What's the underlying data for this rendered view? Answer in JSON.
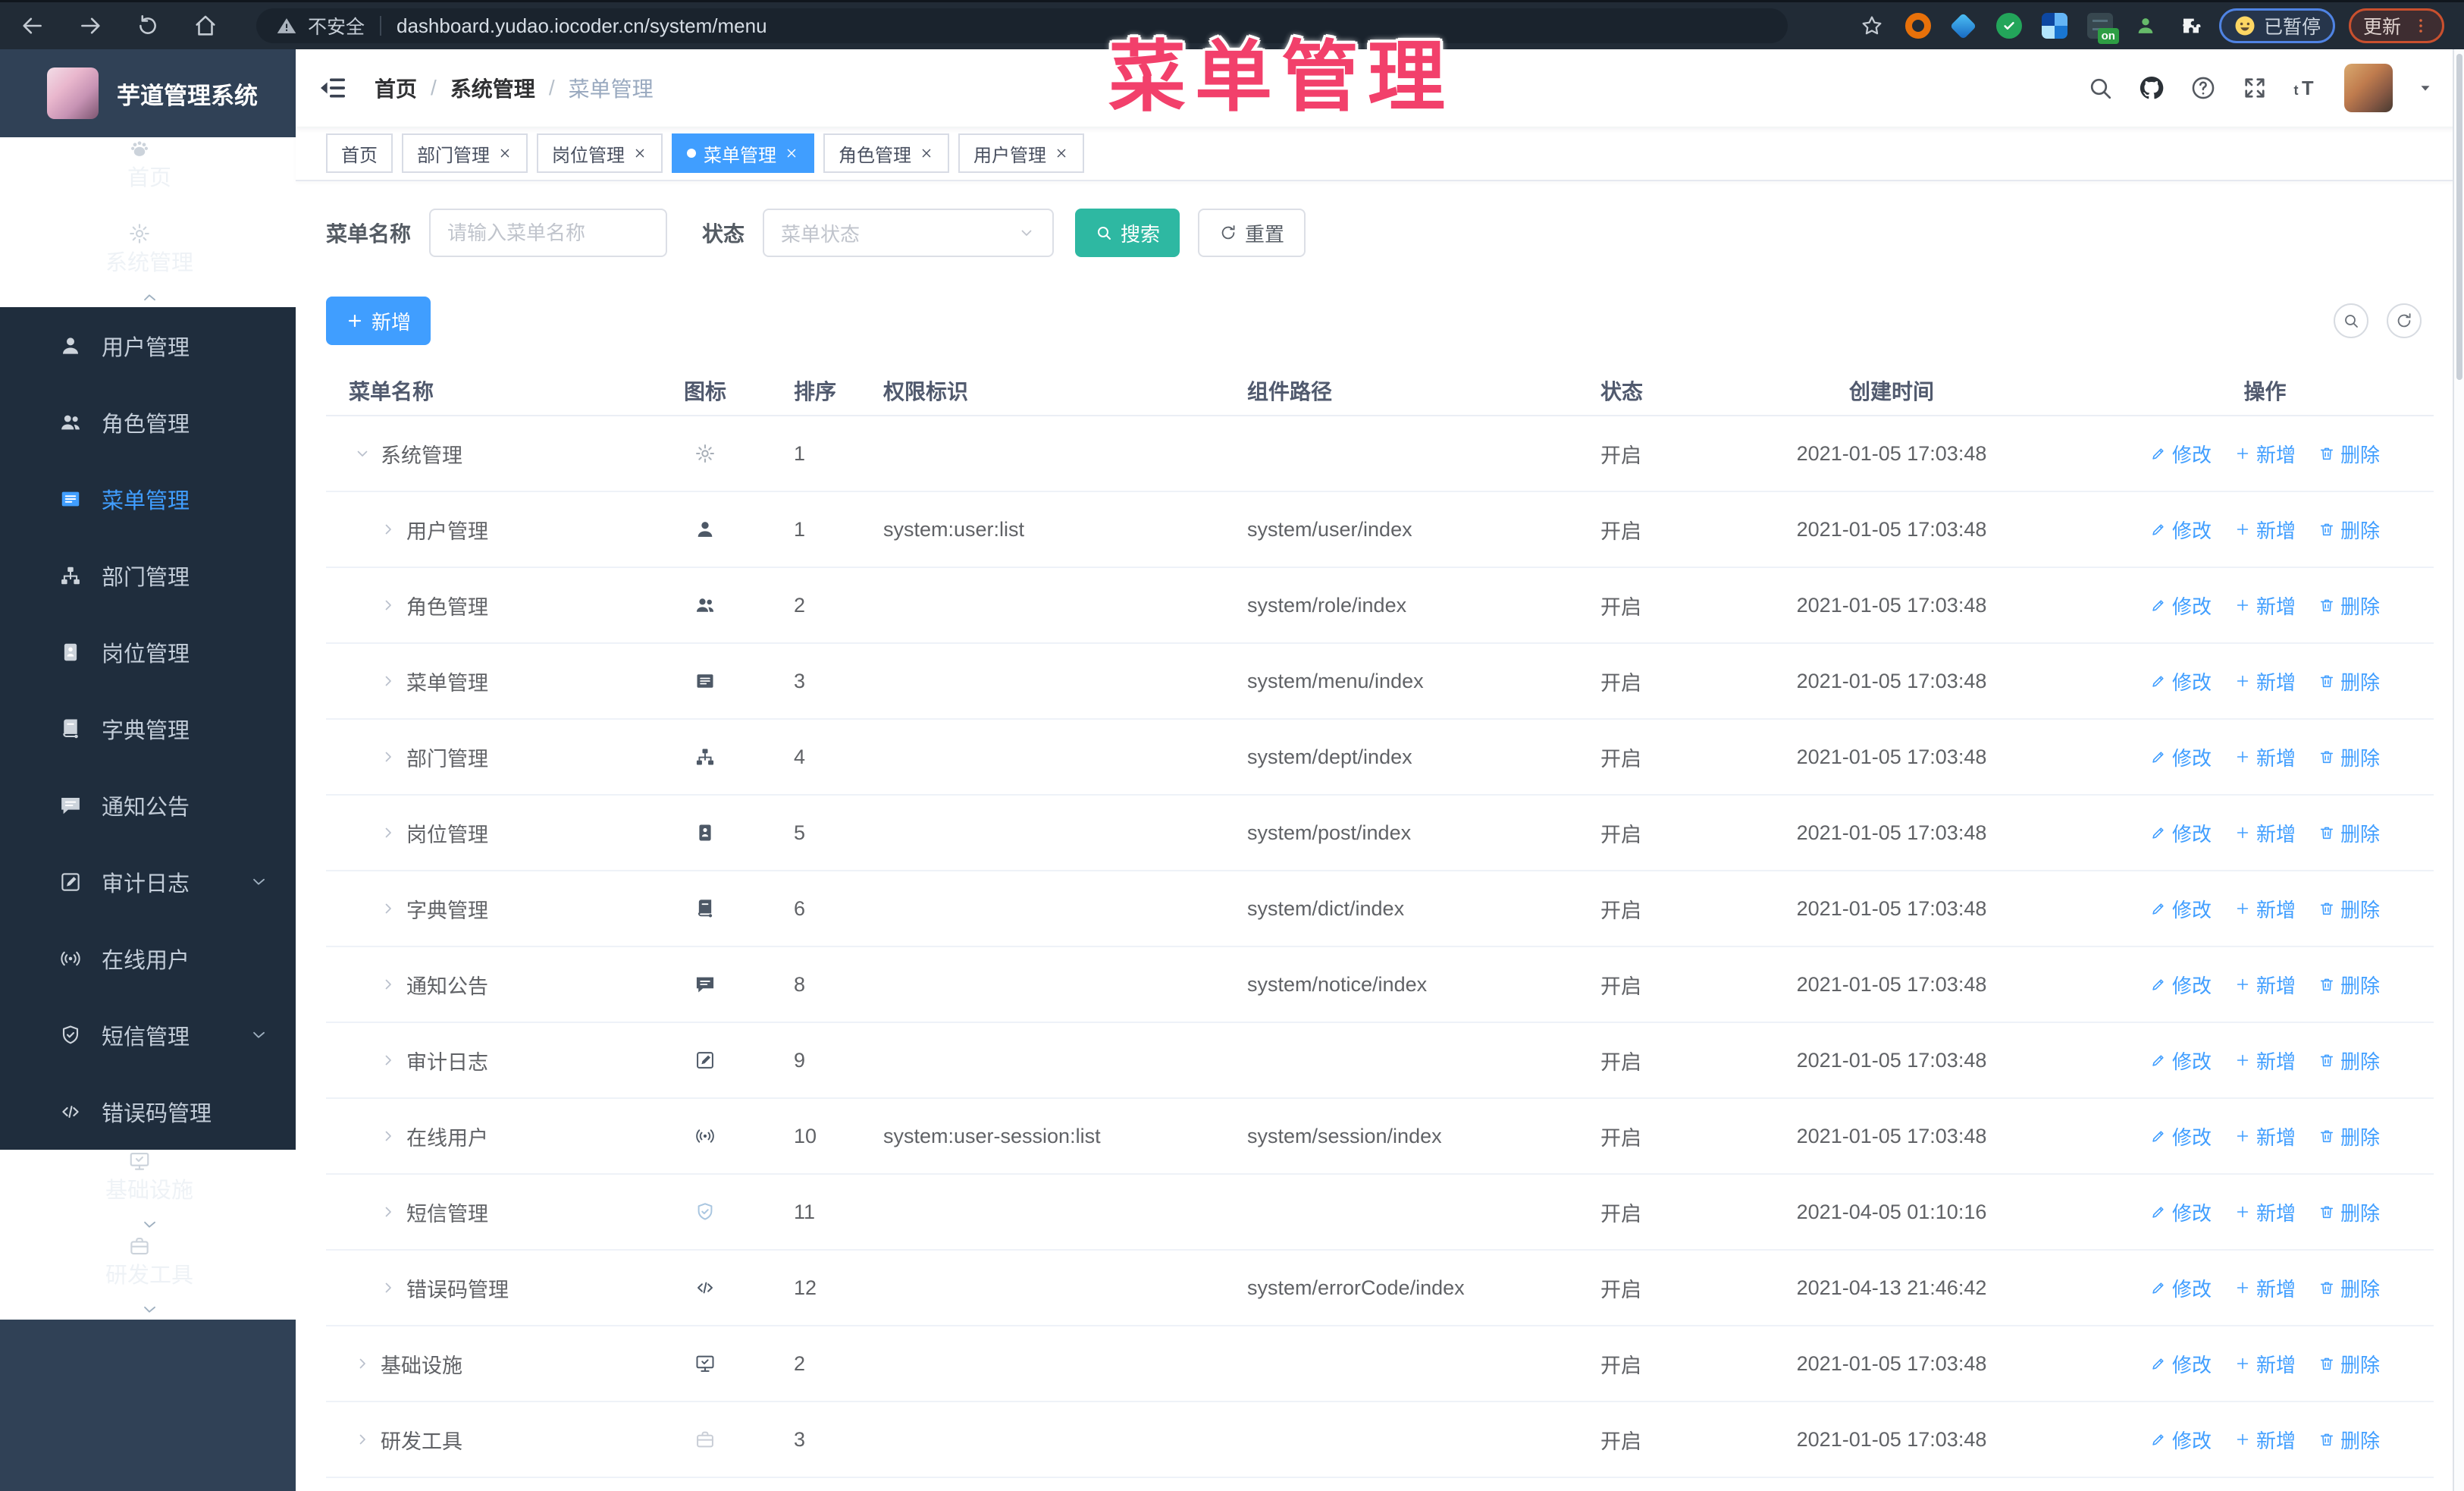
{
  "colors": {
    "primary": "#409eff",
    "search_button_teal": "#2eb8a2",
    "overlay_pink": "#f2406b",
    "sidebar_bg": "#304156",
    "submenu_bg": "#1f2d3d",
    "active_tab_bg": "#409eff"
  },
  "overlay_title": "菜单管理",
  "browser": {
    "security_label": "不安全",
    "url": "dashboard.yudao.iocoder.cn/system/menu",
    "paused_badge": "已暂停",
    "update_badge": "更新",
    "extension_on_badge": "on"
  },
  "sidebar": {
    "logo_title": "芋道管理系统",
    "items": [
      {
        "id": "home",
        "label": "首页",
        "icon": "dashboard",
        "type": "main",
        "active": false,
        "chevron": ""
      },
      {
        "id": "system",
        "label": "系统管理",
        "icon": "gear",
        "type": "main",
        "active": false,
        "chevron": "up"
      },
      {
        "id": "user",
        "label": "用户管理",
        "icon": "user",
        "type": "sub",
        "active": false,
        "chevron": ""
      },
      {
        "id": "role",
        "label": "角色管理",
        "icon": "users",
        "type": "sub",
        "active": false,
        "chevron": ""
      },
      {
        "id": "menu",
        "label": "菜单管理",
        "icon": "menu",
        "type": "sub",
        "active": true,
        "chevron": ""
      },
      {
        "id": "dept",
        "label": "部门管理",
        "icon": "tree",
        "type": "sub",
        "active": false,
        "chevron": ""
      },
      {
        "id": "post",
        "label": "岗位管理",
        "icon": "post",
        "type": "sub",
        "active": false,
        "chevron": ""
      },
      {
        "id": "dict",
        "label": "字典管理",
        "icon": "dict",
        "type": "sub",
        "active": false,
        "chevron": ""
      },
      {
        "id": "notice",
        "label": "通知公告",
        "icon": "notice",
        "type": "sub",
        "active": false,
        "chevron": ""
      },
      {
        "id": "audit-log",
        "label": "审计日志",
        "icon": "log",
        "type": "sub",
        "active": false,
        "chevron": "down"
      },
      {
        "id": "online-user",
        "label": "在线用户",
        "icon": "online",
        "type": "sub",
        "active": false,
        "chevron": ""
      },
      {
        "id": "sms",
        "label": "短信管理",
        "icon": "sms",
        "type": "sub",
        "active": false,
        "chevron": "down"
      },
      {
        "id": "error-code",
        "label": "错误码管理",
        "icon": "code",
        "type": "sub",
        "active": false,
        "chevron": ""
      },
      {
        "id": "infra",
        "label": "基础设施",
        "icon": "infra",
        "type": "main",
        "active": false,
        "chevron": "down"
      },
      {
        "id": "tool",
        "label": "研发工具",
        "icon": "tool",
        "type": "main",
        "active": false,
        "chevron": "down"
      }
    ]
  },
  "navbar": {
    "breadcrumb": [
      "首页",
      "系统管理",
      "菜单管理"
    ],
    "separator": "/"
  },
  "tags": [
    {
      "id": "home",
      "label": "首页",
      "closable": false,
      "active": false
    },
    {
      "id": "dept",
      "label": "部门管理",
      "closable": true,
      "active": false
    },
    {
      "id": "post",
      "label": "岗位管理",
      "closable": true,
      "active": false
    },
    {
      "id": "menu",
      "label": "菜单管理",
      "closable": true,
      "active": true
    },
    {
      "id": "role",
      "label": "角色管理",
      "closable": true,
      "active": false
    },
    {
      "id": "user",
      "label": "用户管理",
      "closable": true,
      "active": false
    }
  ],
  "filter": {
    "name_label": "菜单名称",
    "name_placeholder": "请输入菜单名称",
    "status_label": "状态",
    "status_placeholder": "菜单状态",
    "search_label": "搜索",
    "reset_label": "重置"
  },
  "toolbar": {
    "add_label": "新增"
  },
  "table": {
    "columns": [
      "菜单名称",
      "图标",
      "排序",
      "权限标识",
      "组件路径",
      "状态",
      "创建时间",
      "操作"
    ],
    "action_labels": [
      "修改",
      "新增",
      "删除"
    ],
    "rows": [
      {
        "name": "系统管理",
        "level": 0,
        "expanded": true,
        "icon": "gear",
        "sort": 1,
        "perm": "",
        "path": "",
        "status": "开启",
        "created": "2021-01-05 17:03:48"
      },
      {
        "name": "用户管理",
        "level": 1,
        "expanded": false,
        "icon": "user",
        "sort": 1,
        "perm": "system:user:list",
        "path": "system/user/index",
        "status": "开启",
        "created": "2021-01-05 17:03:48"
      },
      {
        "name": "角色管理",
        "level": 1,
        "expanded": false,
        "icon": "users",
        "sort": 2,
        "perm": "",
        "path": "system/role/index",
        "status": "开启",
        "created": "2021-01-05 17:03:48"
      },
      {
        "name": "菜单管理",
        "level": 1,
        "expanded": false,
        "icon": "menu",
        "sort": 3,
        "perm": "",
        "path": "system/menu/index",
        "status": "开启",
        "created": "2021-01-05 17:03:48"
      },
      {
        "name": "部门管理",
        "level": 1,
        "expanded": false,
        "icon": "tree",
        "sort": 4,
        "perm": "",
        "path": "system/dept/index",
        "status": "开启",
        "created": "2021-01-05 17:03:48"
      },
      {
        "name": "岗位管理",
        "level": 1,
        "expanded": false,
        "icon": "post",
        "sort": 5,
        "perm": "",
        "path": "system/post/index",
        "status": "开启",
        "created": "2021-01-05 17:03:48"
      },
      {
        "name": "字典管理",
        "level": 1,
        "expanded": false,
        "icon": "dict",
        "sort": 6,
        "perm": "",
        "path": "system/dict/index",
        "status": "开启",
        "created": "2021-01-05 17:03:48"
      },
      {
        "name": "通知公告",
        "level": 1,
        "expanded": false,
        "icon": "notice",
        "sort": 8,
        "perm": "",
        "path": "system/notice/index",
        "status": "开启",
        "created": "2021-01-05 17:03:48"
      },
      {
        "name": "审计日志",
        "level": 1,
        "expanded": false,
        "icon": "log",
        "sort": 9,
        "perm": "",
        "path": "",
        "status": "开启",
        "created": "2021-01-05 17:03:48"
      },
      {
        "name": "在线用户",
        "level": 1,
        "expanded": false,
        "icon": "online",
        "sort": 10,
        "perm": "system:user-session:list",
        "path": "system/session/index",
        "status": "开启",
        "created": "2021-01-05 17:03:48"
      },
      {
        "name": "短信管理",
        "level": 1,
        "expanded": false,
        "icon": "sms",
        "sort": 11,
        "perm": "",
        "path": "",
        "status": "开启",
        "created": "2021-04-05 01:10:16"
      },
      {
        "name": "错误码管理",
        "level": 1,
        "expanded": false,
        "icon": "code",
        "sort": 12,
        "perm": "",
        "path": "system/errorCode/index",
        "status": "开启",
        "created": "2021-04-13 21:46:42"
      },
      {
        "name": "基础设施",
        "level": 0,
        "expanded": false,
        "icon": "infra",
        "sort": 2,
        "perm": "",
        "path": "",
        "status": "开启",
        "created": "2021-01-05 17:03:48"
      },
      {
        "name": "研发工具",
        "level": 0,
        "expanded": false,
        "icon": "tool",
        "sort": 3,
        "perm": "",
        "path": "",
        "status": "开启",
        "created": "2021-01-05 17:03:48"
      }
    ]
  }
}
